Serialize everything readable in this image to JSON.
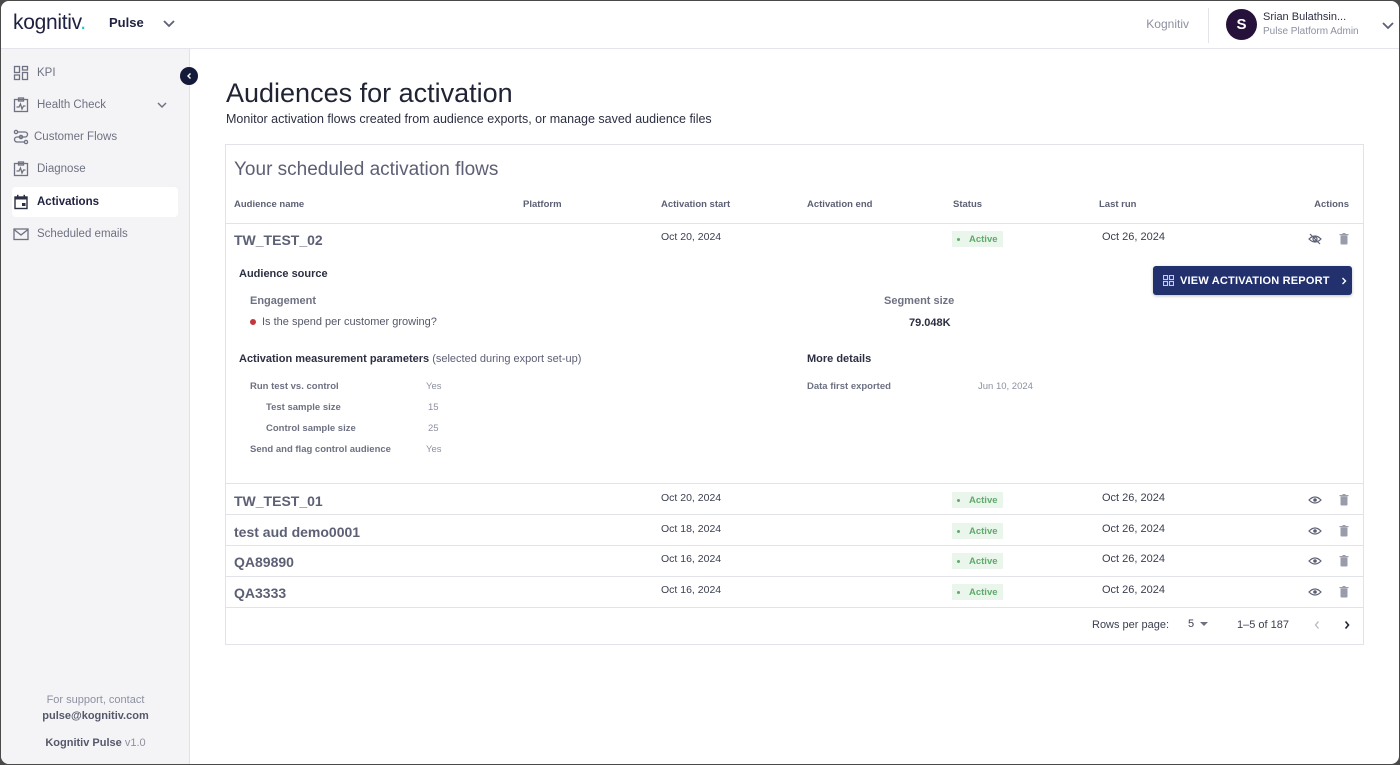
{
  "header": {
    "logo_main": "kognitiv",
    "logo_dot": ".",
    "app_name": "Pulse",
    "org_link": "Kognitiv",
    "user": {
      "initial": "S",
      "name": "Srian Bulathsin...",
      "role": "Pulse Platform Admin"
    }
  },
  "sidebar": {
    "items": [
      {
        "label": "KPI",
        "icon": "dashboard-icon"
      },
      {
        "label": "Health Check",
        "icon": "health-chart-icon",
        "expandable": true
      },
      {
        "label": "Customer Flows",
        "icon": "flow-icon"
      },
      {
        "label": "Diagnose",
        "icon": "diagnose-chart-icon"
      },
      {
        "label": "Activations",
        "icon": "calendar-icon",
        "active": true
      },
      {
        "label": "Scheduled emails",
        "icon": "mail-icon"
      }
    ],
    "support_text": "For support, contact",
    "support_email": "pulse@kognitiv.com",
    "product_name": "Kognitiv Pulse",
    "version": "v1.0"
  },
  "page": {
    "title": "Audiences for activation",
    "subtitle": "Monitor activation flows created from audience exports, or manage saved audience files"
  },
  "flows": {
    "title": "Your scheduled activation flows",
    "columns": [
      "Audience name",
      "Platform",
      "Activation start",
      "Activation end",
      "Status",
      "Last run",
      "Actions"
    ],
    "rows": [
      {
        "name": "TW_TEST_02",
        "platform": "",
        "start": "Oct 20, 2024",
        "end": "",
        "status": "Active",
        "last_run": "Oct 26, 2024",
        "expanded": true
      },
      {
        "name": "TW_TEST_01",
        "platform": "",
        "start": "Oct 20, 2024",
        "end": "",
        "status": "Active",
        "last_run": "Oct 26, 2024"
      },
      {
        "name": "test aud demo0001",
        "platform": "",
        "start": "Oct 18, 2024",
        "end": "",
        "status": "Active",
        "last_run": "Oct 26, 2024"
      },
      {
        "name": "QA89890",
        "platform": "",
        "start": "Oct 16, 2024",
        "end": "",
        "status": "Active",
        "last_run": "Oct 26, 2024"
      },
      {
        "name": "QA3333",
        "platform": "",
        "start": "Oct 16, 2024",
        "end": "",
        "status": "Active",
        "last_run": "Oct 26, 2024"
      }
    ],
    "details": {
      "audience_source_label": "Audience source",
      "category": "Engagement",
      "question": "Is the spend per customer growing?",
      "segment_size_label": "Segment size",
      "segment_size": "79.048K",
      "view_report_label": "VIEW ACTIVATION REPORT",
      "params_label": "Activation measurement parameters",
      "params_note": "(selected during export set-up)",
      "params": [
        {
          "label": "Run test vs. control",
          "value": "Yes"
        },
        {
          "label": "Test sample size",
          "value": "15"
        },
        {
          "label": "Control sample size",
          "value": "25"
        },
        {
          "label": "Send and flag control audience",
          "value": "Yes"
        }
      ],
      "more_details_label": "More details",
      "data_first_exported_label": "Data first exported",
      "data_first_exported": "Jun 10, 2024"
    },
    "pagination": {
      "rows_per_page_label": "Rows per page:",
      "rows_per_page": "5",
      "range": "1–5 of 187"
    }
  },
  "colors": {
    "brand_navy": "#22306e",
    "accent_teal": "#20c1c2",
    "status_active": "#5faa6c",
    "avatar": "#251139"
  }
}
